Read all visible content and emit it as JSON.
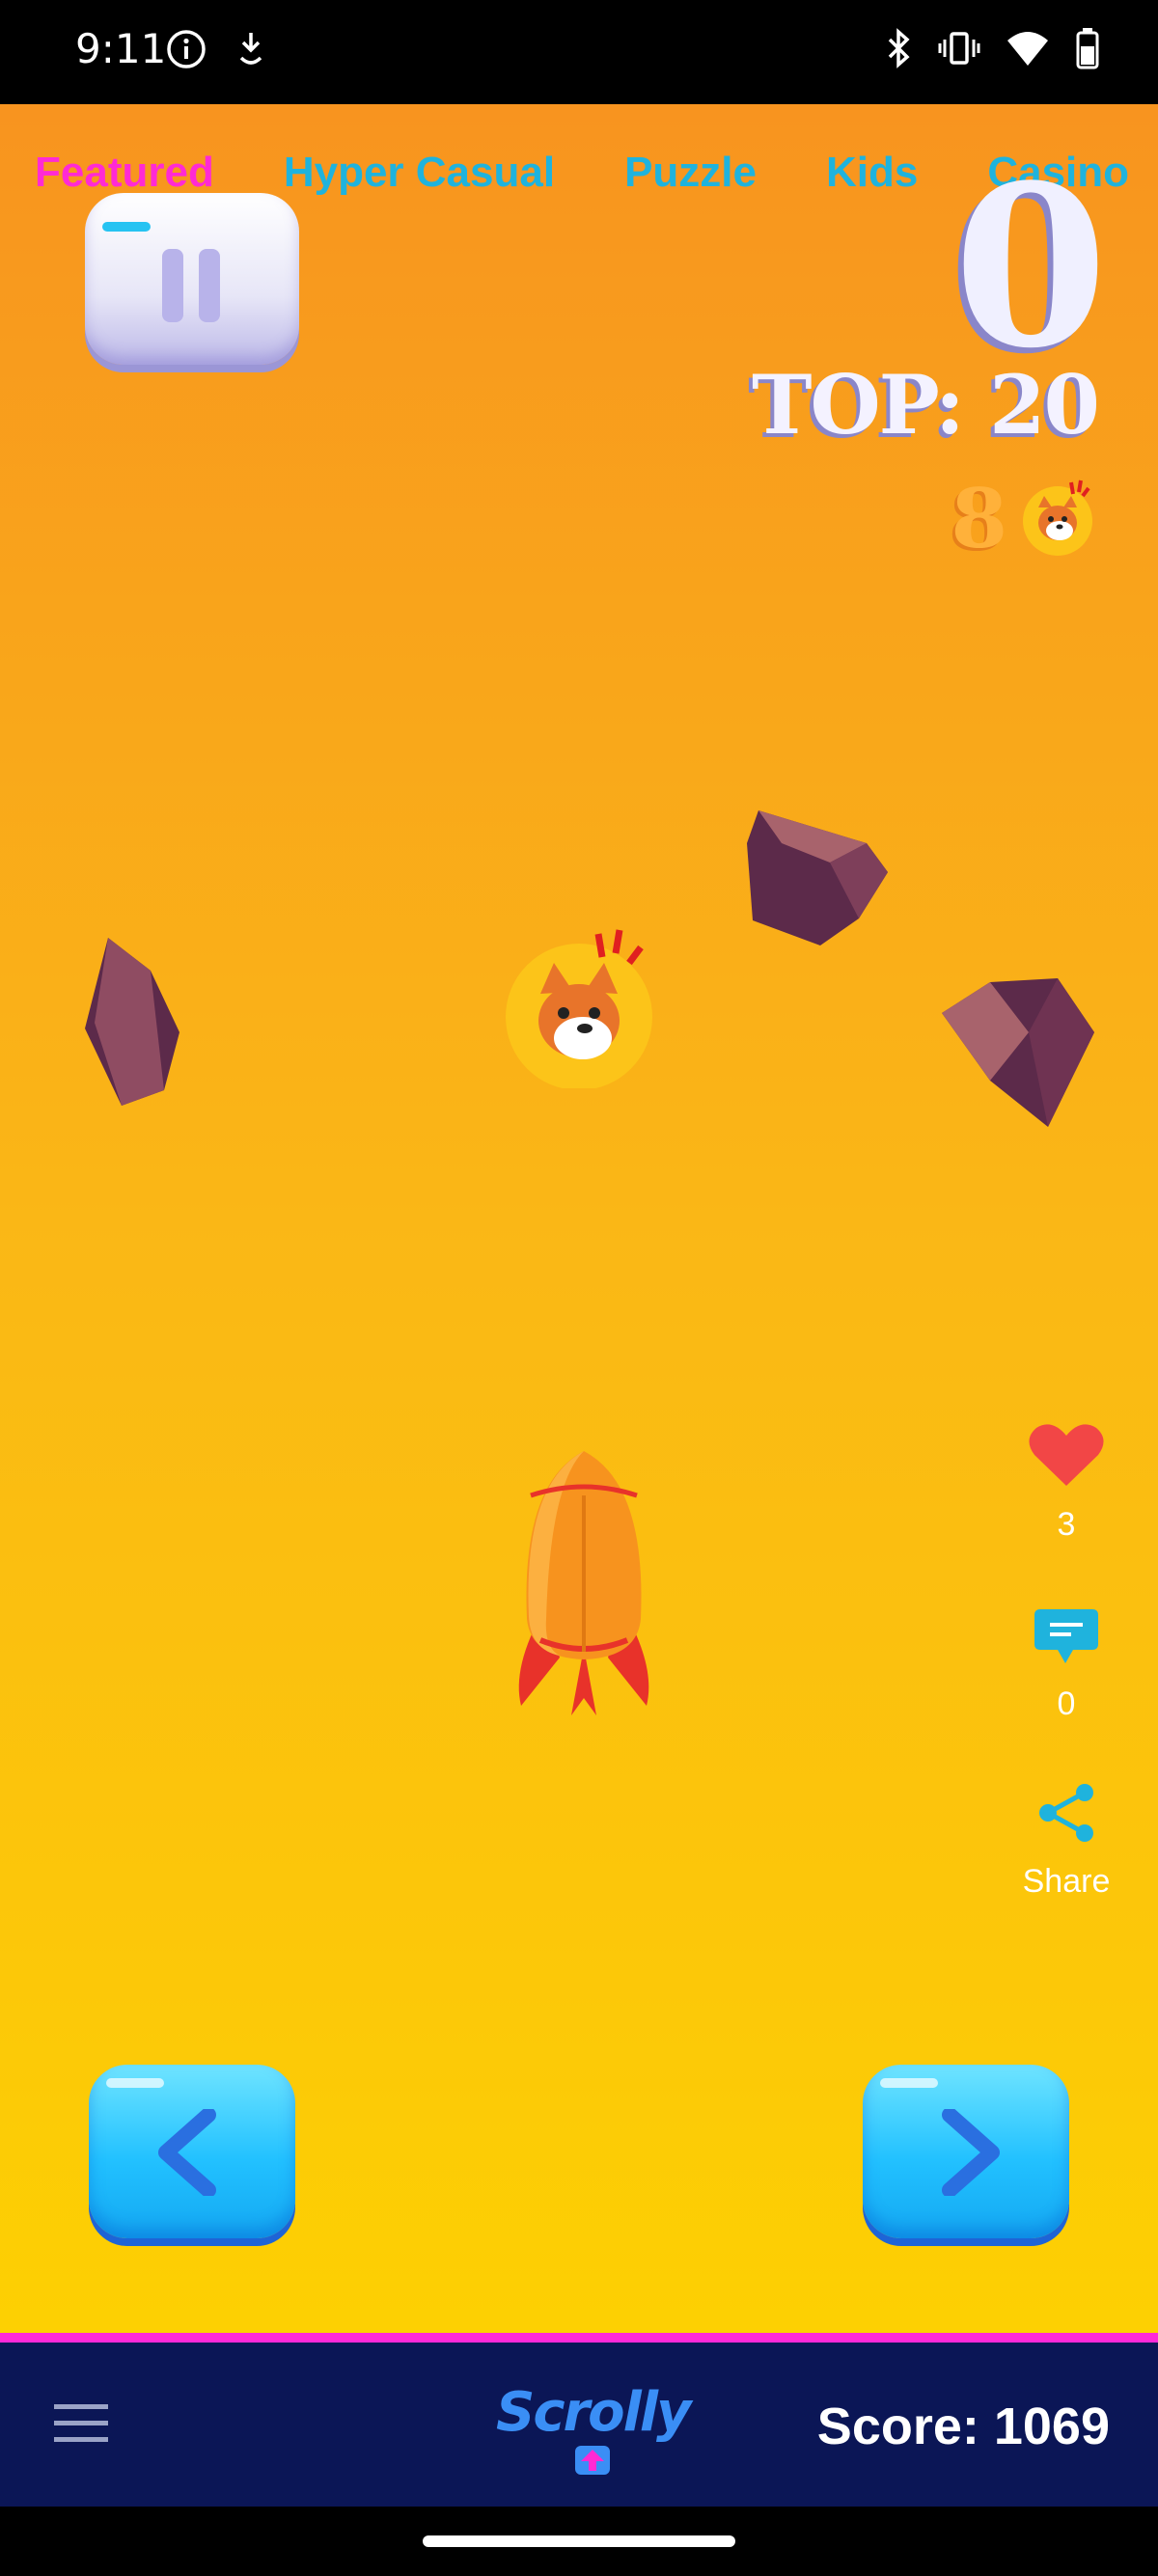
{
  "status_bar": {
    "time": "9:11",
    "icons": [
      "info-icon",
      "download-icon",
      "bluetooth-icon",
      "vibrate-icon",
      "wifi-icon",
      "battery-icon"
    ]
  },
  "tabs": [
    {
      "label": "Featured",
      "active": true
    },
    {
      "label": "Hyper Casual",
      "active": false
    },
    {
      "label": "Puzzle",
      "active": false
    },
    {
      "label": "Kids",
      "active": false
    },
    {
      "label": "Casino",
      "active": false
    }
  ],
  "game": {
    "current_score": "0",
    "top_score": "TOP: 20",
    "coins": "8"
  },
  "social": {
    "likes": "3",
    "comments": "0",
    "share_label": "Share"
  },
  "footer": {
    "logo": "Scrolly",
    "score": "Score: 1069"
  },
  "colors": {
    "tab_active": "#ff2ad4",
    "tab_inactive": "#1fb3dd",
    "footer_bg": "#0b1656",
    "footer_border": "#ff29d9"
  }
}
